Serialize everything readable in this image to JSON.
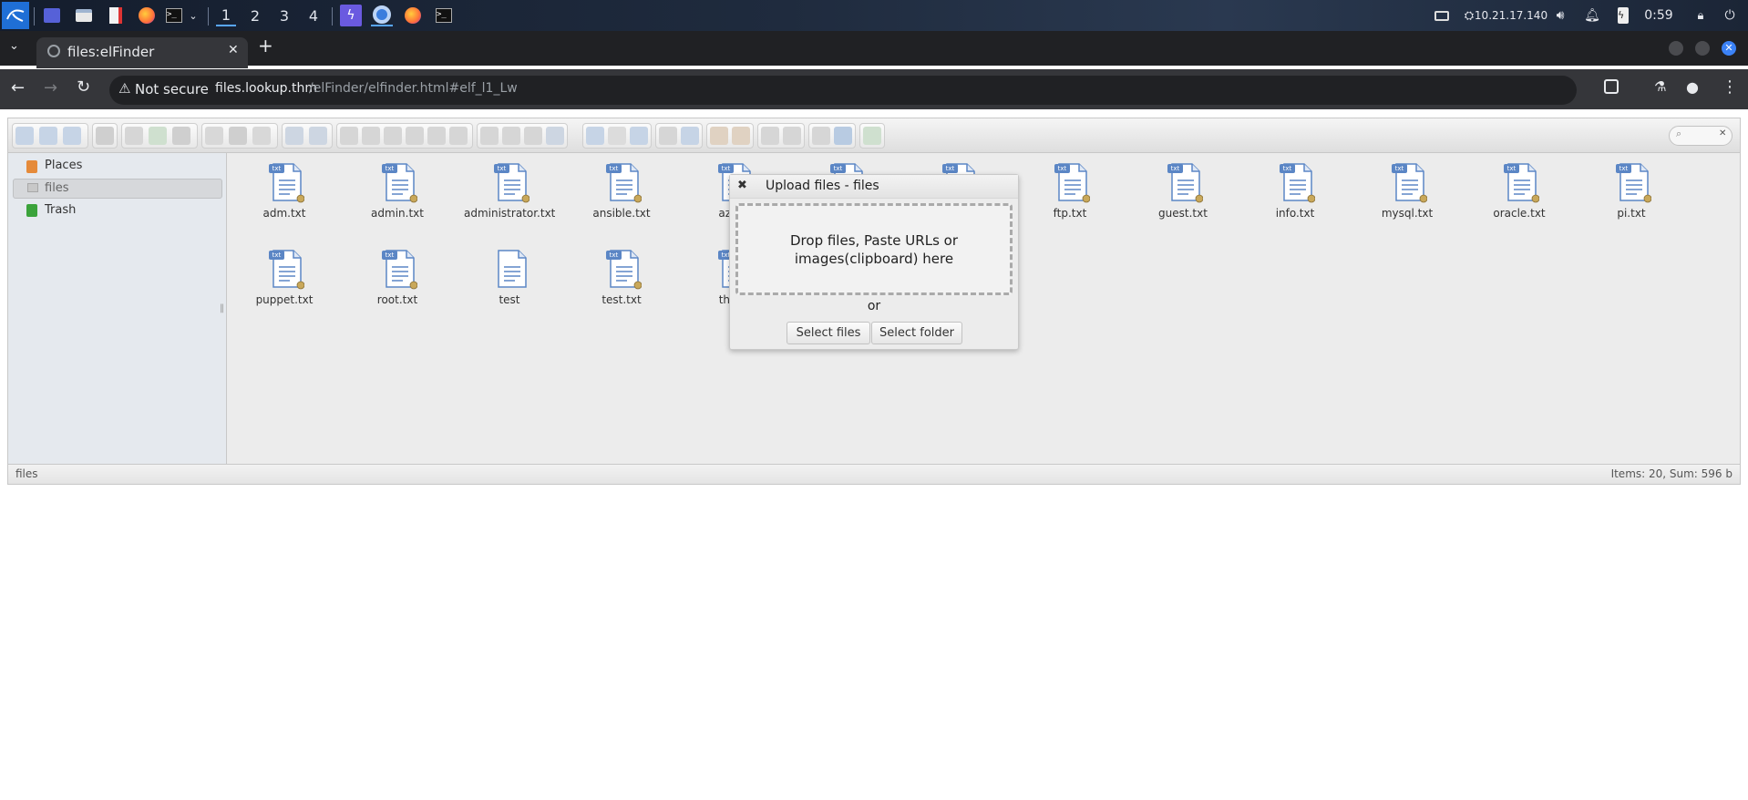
{
  "taskbar": {
    "workspaces": [
      "1",
      "2",
      "3",
      "4"
    ],
    "active_workspace": "1",
    "ip": "10.21.17.140",
    "time": "0:59",
    "icons": [
      "kali-menu-icon",
      "terminal-app-icon",
      "file-manager-icon",
      "text-editor-icon",
      "firefox-icon",
      "terminal-icon",
      "burpsuite-icon",
      "chromium-icon",
      "firefox-icon",
      "terminal-icon"
    ]
  },
  "browser": {
    "tab_title": "files:elFinder",
    "security_label": "Not secure",
    "url_host": "files.lookup.thm",
    "url_path": "/elFinder/elfinder.html#elf_l1_Lw"
  },
  "elfinder": {
    "nav": {
      "places": "Places",
      "files": "files",
      "trash": "Trash"
    },
    "files": [
      {
        "name": "adm.txt",
        "ext": "txt"
      },
      {
        "name": "admin.txt",
        "ext": "txt"
      },
      {
        "name": "administrator.txt",
        "ext": "txt"
      },
      {
        "name": "ansible.txt",
        "ext": "txt"
      },
      {
        "name": "azure",
        "ext": "txt"
      },
      {
        "name": "",
        "ext": "txt"
      },
      {
        "name": "",
        "ext": "txt"
      },
      {
        "name": "ftp.txt",
        "ext": "txt"
      },
      {
        "name": "guest.txt",
        "ext": "txt"
      },
      {
        "name": "info.txt",
        "ext": "txt"
      },
      {
        "name": "mysql.txt",
        "ext": "txt"
      },
      {
        "name": "oracle.txt",
        "ext": "txt"
      },
      {
        "name": "pi.txt",
        "ext": "txt"
      },
      {
        "name": "puppet.txt",
        "ext": "txt"
      },
      {
        "name": "root.txt",
        "ext": "txt"
      },
      {
        "name": "test",
        "ext": ""
      },
      {
        "name": "test.txt",
        "ext": "txt"
      },
      {
        "name": "thislo",
        "ext": "txt"
      }
    ],
    "status_path": "files",
    "status_info": "Items: 20, Sum: 596 b"
  },
  "upload_dialog": {
    "title": "Upload files - files",
    "drop_text": "Drop files, Paste URLs or images(clipboard) here",
    "or": "or",
    "select_files": "Select files",
    "select_folder": "Select folder"
  }
}
